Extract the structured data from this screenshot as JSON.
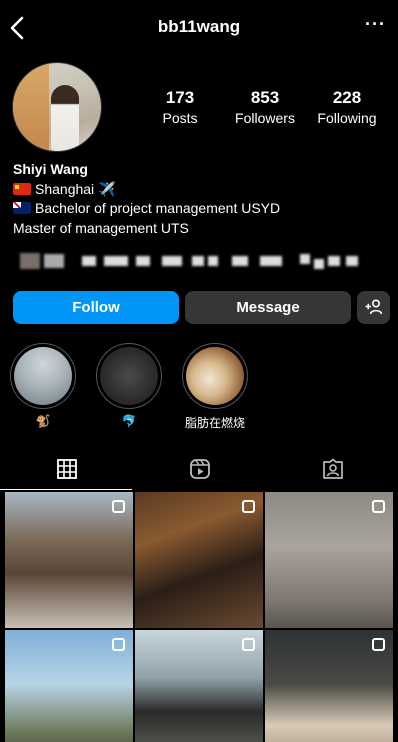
{
  "header": {
    "handle": "bb11wang",
    "back_icon": "chevron-left-icon",
    "more_icon": "more-horizontal-icon",
    "more_glyph": "···"
  },
  "profile": {
    "avatar_icon": "profile-avatar"
  },
  "stats": [
    {
      "value": "173",
      "label": "Posts"
    },
    {
      "value": "853",
      "label": "Followers"
    },
    {
      "value": "228",
      "label": "Following"
    }
  ],
  "bio": {
    "name": "Shiyi Wang",
    "line1_flag": "china-flag-icon",
    "line1_text": "Shanghai",
    "line1_emoji": "✈️",
    "line2_flag": "australia-flag-icon",
    "line2_text": "Bachelor of project management USYD",
    "line3_text": "Master of management UTS"
  },
  "buttons": {
    "follow": "Follow",
    "message": "Message",
    "add_icon": "add-person-icon",
    "add_glyph": "+♙"
  },
  "highlights": [
    {
      "caption": "🐒",
      "icon": "highlight-cover-1"
    },
    {
      "caption": "🐬",
      "icon": "highlight-cover-2"
    },
    {
      "caption": "脂肪在燃烧",
      "icon": "highlight-cover-3"
    }
  ],
  "tabs": [
    {
      "name": "grid",
      "icon": "grid-icon",
      "active": true
    },
    {
      "name": "reels",
      "icon": "reels-icon",
      "active": false
    },
    {
      "name": "tagged",
      "icon": "tagged-icon",
      "active": false
    }
  ],
  "colors": {
    "background": "#000000",
    "follow_button": "#0095f6",
    "secondary_button": "#363636"
  }
}
